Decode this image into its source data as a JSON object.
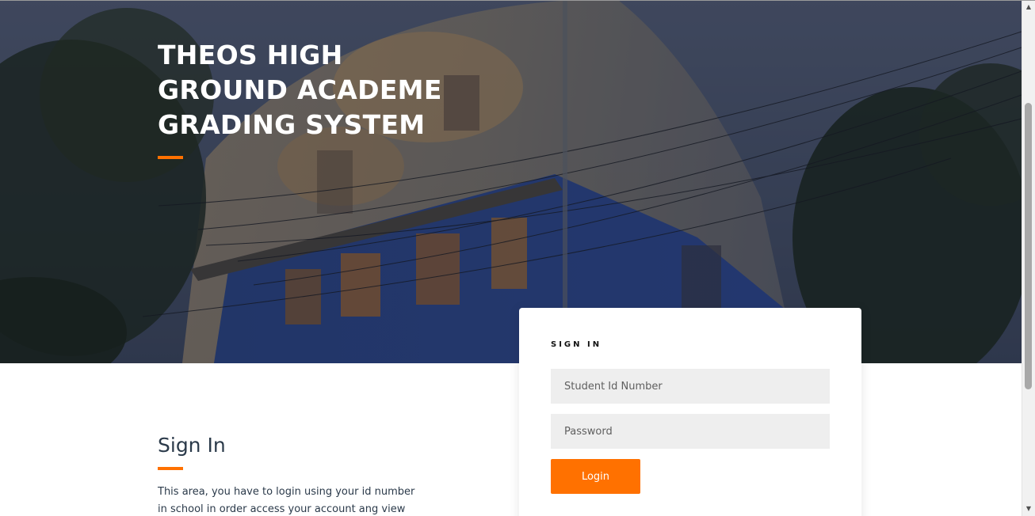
{
  "hero": {
    "title_lines": [
      "THEOS HIGH",
      "GROUND ACADEME",
      "GRADING SYSTEM"
    ]
  },
  "intro": {
    "heading": "Sign In",
    "text": "This area, you have to login using your id number in school in order access your account ang view your"
  },
  "login_card": {
    "title": "SIGN IN",
    "student_id_placeholder": "Student Id Number",
    "password_placeholder": "Password",
    "login_label": "Login"
  },
  "colors": {
    "accent": "#ff7100",
    "heading_text": "#2b3a4a",
    "input_bg": "#eeeeee"
  },
  "icons": {
    "scroll_up": "scroll-up-arrow-icon",
    "scroll_down": "scroll-down-arrow-icon"
  }
}
